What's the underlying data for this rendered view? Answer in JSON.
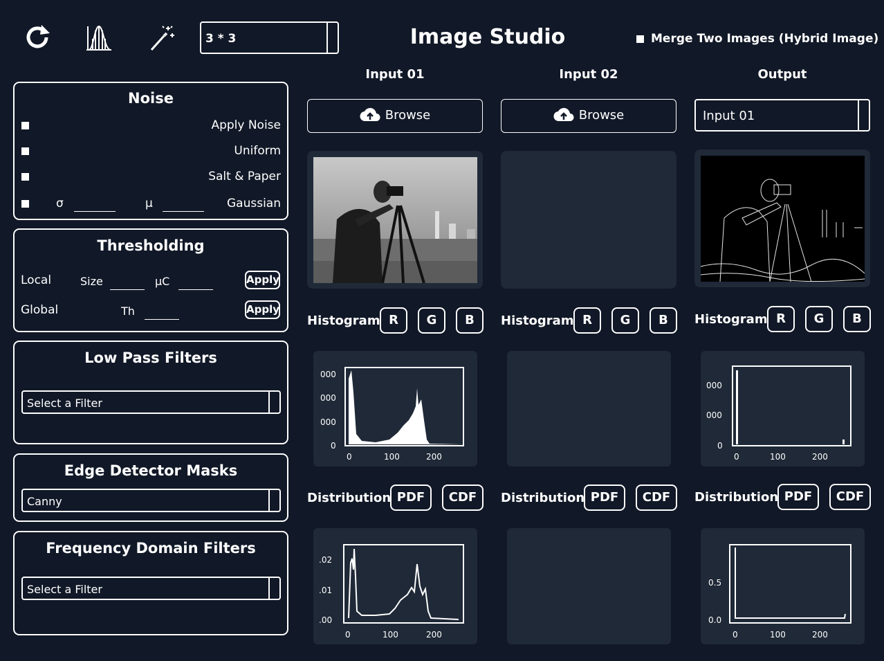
{
  "toolbar": {
    "kernel_size": "3 * 3"
  },
  "app_title": "Image Studio",
  "merge": {
    "label": "Merge Two Images (Hybrid Image)",
    "checked": false
  },
  "noise": {
    "title": "Noise",
    "apply_label": "Apply Noise",
    "uniform_label": "Uniform",
    "salt_label": "Salt & Paper",
    "sigma_label": "σ",
    "mu_label": "μ",
    "gaussian_label": "Gaussian"
  },
  "thresholding": {
    "title": "Thresholding",
    "local_label": "Local",
    "size_label": "Size",
    "uc_label": "μC",
    "global_label": "Global",
    "th_label": "Th",
    "apply_label": "Apply"
  },
  "low_pass": {
    "title": "Low Pass Filters",
    "selected": "Select a Filter"
  },
  "edge": {
    "title": "Edge Detector Masks",
    "selected": "Canny"
  },
  "freq": {
    "title": "Frequency Domain Filters",
    "selected": "Select a Filter"
  },
  "columns": {
    "input1": "Input 01",
    "input2": "Input 02",
    "output": "Output",
    "browse_label": "Browse",
    "output_select": "Input 01",
    "histogram_label": "Histogram",
    "distribution_label": "Distribution",
    "r": "R",
    "g": "G",
    "b": "B",
    "pdf": "PDF",
    "cdf": "CDF"
  },
  "chart_data": [
    {
      "type": "bar",
      "name": "input1-histogram",
      "xticks": [
        "0",
        "100",
        "200"
      ],
      "yticks": [
        "0",
        "000",
        "000",
        "000"
      ],
      "xlim": [
        0,
        255
      ]
    },
    {
      "type": "line",
      "name": "input1-distribution",
      "xticks": [
        "0",
        "100",
        "200"
      ],
      "yticks": [
        ".00",
        ".01",
        ".02"
      ],
      "xlim": [
        0,
        255
      ],
      "ylim": [
        0,
        0.025
      ]
    },
    {
      "type": "bar",
      "name": "output-histogram",
      "xticks": [
        "0",
        "100",
        "200"
      ],
      "yticks": [
        "0",
        "000",
        "000"
      ],
      "xlim": [
        0,
        255
      ]
    },
    {
      "type": "line",
      "name": "output-distribution",
      "xticks": [
        "0",
        "100",
        "200"
      ],
      "yticks": [
        "0.0",
        "0.5"
      ],
      "xlim": [
        0,
        255
      ],
      "ylim": [
        0,
        1
      ]
    }
  ]
}
